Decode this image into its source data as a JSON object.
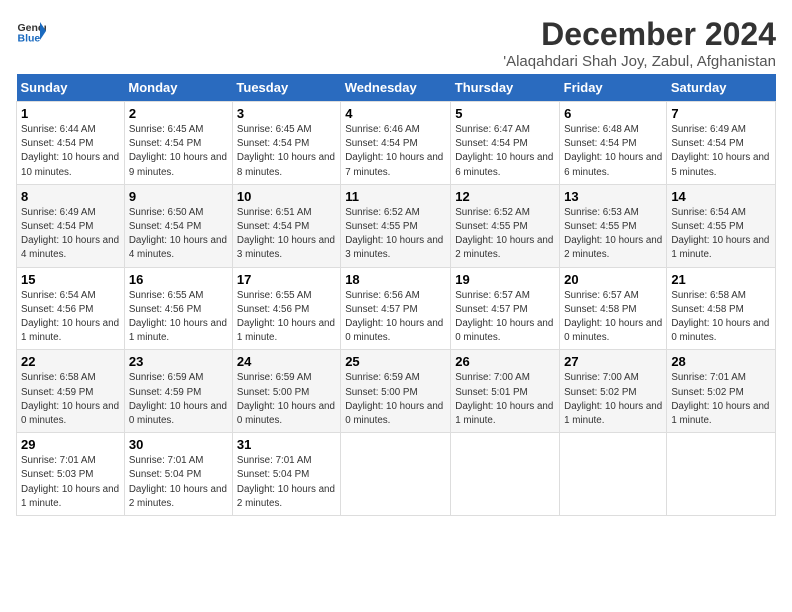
{
  "logo": {
    "text_general": "General",
    "text_blue": "Blue"
  },
  "header": {
    "month_year": "December 2024",
    "location": "'Alaqahdari Shah Joy, Zabul, Afghanistan"
  },
  "days_of_week": [
    "Sunday",
    "Monday",
    "Tuesday",
    "Wednesday",
    "Thursday",
    "Friday",
    "Saturday"
  ],
  "weeks": [
    [
      {
        "day": "1",
        "sunrise": "6:44 AM",
        "sunset": "4:54 PM",
        "daylight": "10 hours and 10 minutes."
      },
      {
        "day": "2",
        "sunrise": "6:45 AM",
        "sunset": "4:54 PM",
        "daylight": "10 hours and 9 minutes."
      },
      {
        "day": "3",
        "sunrise": "6:45 AM",
        "sunset": "4:54 PM",
        "daylight": "10 hours and 8 minutes."
      },
      {
        "day": "4",
        "sunrise": "6:46 AM",
        "sunset": "4:54 PM",
        "daylight": "10 hours and 7 minutes."
      },
      {
        "day": "5",
        "sunrise": "6:47 AM",
        "sunset": "4:54 PM",
        "daylight": "10 hours and 6 minutes."
      },
      {
        "day": "6",
        "sunrise": "6:48 AM",
        "sunset": "4:54 PM",
        "daylight": "10 hours and 6 minutes."
      },
      {
        "day": "7",
        "sunrise": "6:49 AM",
        "sunset": "4:54 PM",
        "daylight": "10 hours and 5 minutes."
      }
    ],
    [
      {
        "day": "8",
        "sunrise": "6:49 AM",
        "sunset": "4:54 PM",
        "daylight": "10 hours and 4 minutes."
      },
      {
        "day": "9",
        "sunrise": "6:50 AM",
        "sunset": "4:54 PM",
        "daylight": "10 hours and 4 minutes."
      },
      {
        "day": "10",
        "sunrise": "6:51 AM",
        "sunset": "4:54 PM",
        "daylight": "10 hours and 3 minutes."
      },
      {
        "day": "11",
        "sunrise": "6:52 AM",
        "sunset": "4:55 PM",
        "daylight": "10 hours and 3 minutes."
      },
      {
        "day": "12",
        "sunrise": "6:52 AM",
        "sunset": "4:55 PM",
        "daylight": "10 hours and 2 minutes."
      },
      {
        "day": "13",
        "sunrise": "6:53 AM",
        "sunset": "4:55 PM",
        "daylight": "10 hours and 2 minutes."
      },
      {
        "day": "14",
        "sunrise": "6:54 AM",
        "sunset": "4:55 PM",
        "daylight": "10 hours and 1 minute."
      }
    ],
    [
      {
        "day": "15",
        "sunrise": "6:54 AM",
        "sunset": "4:56 PM",
        "daylight": "10 hours and 1 minute."
      },
      {
        "day": "16",
        "sunrise": "6:55 AM",
        "sunset": "4:56 PM",
        "daylight": "10 hours and 1 minute."
      },
      {
        "day": "17",
        "sunrise": "6:55 AM",
        "sunset": "4:56 PM",
        "daylight": "10 hours and 1 minute."
      },
      {
        "day": "18",
        "sunrise": "6:56 AM",
        "sunset": "4:57 PM",
        "daylight": "10 hours and 0 minutes."
      },
      {
        "day": "19",
        "sunrise": "6:57 AM",
        "sunset": "4:57 PM",
        "daylight": "10 hours and 0 minutes."
      },
      {
        "day": "20",
        "sunrise": "6:57 AM",
        "sunset": "4:58 PM",
        "daylight": "10 hours and 0 minutes."
      },
      {
        "day": "21",
        "sunrise": "6:58 AM",
        "sunset": "4:58 PM",
        "daylight": "10 hours and 0 minutes."
      }
    ],
    [
      {
        "day": "22",
        "sunrise": "6:58 AM",
        "sunset": "4:59 PM",
        "daylight": "10 hours and 0 minutes."
      },
      {
        "day": "23",
        "sunrise": "6:59 AM",
        "sunset": "4:59 PM",
        "daylight": "10 hours and 0 minutes."
      },
      {
        "day": "24",
        "sunrise": "6:59 AM",
        "sunset": "5:00 PM",
        "daylight": "10 hours and 0 minutes."
      },
      {
        "day": "25",
        "sunrise": "6:59 AM",
        "sunset": "5:00 PM",
        "daylight": "10 hours and 0 minutes."
      },
      {
        "day": "26",
        "sunrise": "7:00 AM",
        "sunset": "5:01 PM",
        "daylight": "10 hours and 1 minute."
      },
      {
        "day": "27",
        "sunrise": "7:00 AM",
        "sunset": "5:02 PM",
        "daylight": "10 hours and 1 minute."
      },
      {
        "day": "28",
        "sunrise": "7:01 AM",
        "sunset": "5:02 PM",
        "daylight": "10 hours and 1 minute."
      }
    ],
    [
      {
        "day": "29",
        "sunrise": "7:01 AM",
        "sunset": "5:03 PM",
        "daylight": "10 hours and 1 minute."
      },
      {
        "day": "30",
        "sunrise": "7:01 AM",
        "sunset": "5:04 PM",
        "daylight": "10 hours and 2 minutes."
      },
      {
        "day": "31",
        "sunrise": "7:01 AM",
        "sunset": "5:04 PM",
        "daylight": "10 hours and 2 minutes."
      },
      null,
      null,
      null,
      null
    ]
  ]
}
